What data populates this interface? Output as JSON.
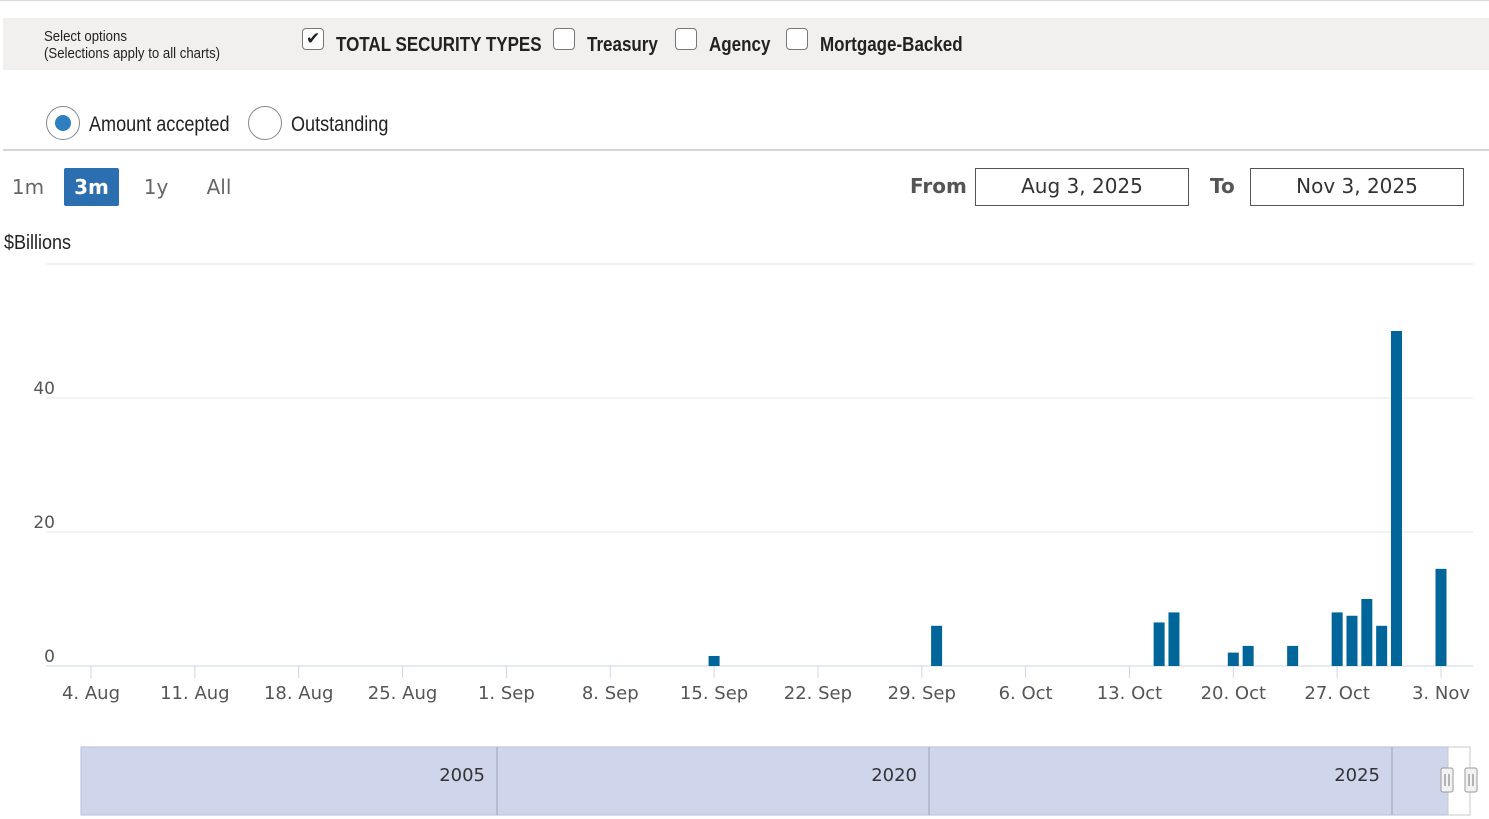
{
  "options": {
    "label_line1": "Select options",
    "label_line2": "(Selections apply to all charts)",
    "checkboxes": [
      {
        "label": "TOTAL SECURITY TYPES",
        "checked": true
      },
      {
        "label": "Treasury",
        "checked": false
      },
      {
        "label": "Agency",
        "checked": false
      },
      {
        "label": "Mortgage-Backed",
        "checked": false
      }
    ],
    "radios": [
      {
        "label": "Amount accepted",
        "selected": true
      },
      {
        "label": "Outstanding",
        "selected": false
      }
    ]
  },
  "range_selector": {
    "buttons": [
      "1m",
      "3m",
      "1y",
      "All"
    ],
    "active": "3m",
    "from_label": "From",
    "to_label": "To",
    "from_value": "Aug 3, 2025",
    "to_value": "Nov 3, 2025"
  },
  "colors": {
    "bar": "#006699",
    "active_button": "#2b6fb0",
    "navigator_fill": "#cfd6ec",
    "radio_dot": "#2d7fbf"
  },
  "chart_data": {
    "type": "bar",
    "ylabel": "$Billions",
    "ylim": [
      0,
      60
    ],
    "y_ticks": [
      "0",
      "20",
      "40"
    ],
    "x_range": [
      "2025-08-02",
      "2025-11-04"
    ],
    "x_ticks": [
      {
        "date": "2025-08-04",
        "label": "4. Aug"
      },
      {
        "date": "2025-08-11",
        "label": "11. Aug"
      },
      {
        "date": "2025-08-18",
        "label": "18. Aug"
      },
      {
        "date": "2025-08-25",
        "label": "25. Aug"
      },
      {
        "date": "2025-09-01",
        "label": "1. Sep"
      },
      {
        "date": "2025-09-08",
        "label": "8. Sep"
      },
      {
        "date": "2025-09-15",
        "label": "15. Sep"
      },
      {
        "date": "2025-09-22",
        "label": "22. Sep"
      },
      {
        "date": "2025-09-29",
        "label": "29. Sep"
      },
      {
        "date": "2025-10-06",
        "label": "6. Oct"
      },
      {
        "date": "2025-10-13",
        "label": "13. Oct"
      },
      {
        "date": "2025-10-20",
        "label": "20. Oct"
      },
      {
        "date": "2025-10-27",
        "label": "27. Oct"
      },
      {
        "date": "2025-11-03",
        "label": "3. Nov"
      }
    ],
    "points": [
      {
        "date": "2025-09-15",
        "value": 1.5
      },
      {
        "date": "2025-09-30",
        "value": 6
      },
      {
        "date": "2025-10-15",
        "value": 6.5
      },
      {
        "date": "2025-10-16",
        "value": 8
      },
      {
        "date": "2025-10-20",
        "value": 2
      },
      {
        "date": "2025-10-21",
        "value": 3
      },
      {
        "date": "2025-10-24",
        "value": 3
      },
      {
        "date": "2025-10-27",
        "value": 8
      },
      {
        "date": "2025-10-28",
        "value": 7.5
      },
      {
        "date": "2025-10-29",
        "value": 10
      },
      {
        "date": "2025-10-30",
        "value": 6
      },
      {
        "date": "2025-10-31",
        "value": 50
      },
      {
        "date": "2025-11-03",
        "value": 14.5
      }
    ],
    "grid": true,
    "legend": "none"
  },
  "navigator": {
    "labels": [
      "2005",
      "2020",
      "2025"
    ]
  }
}
